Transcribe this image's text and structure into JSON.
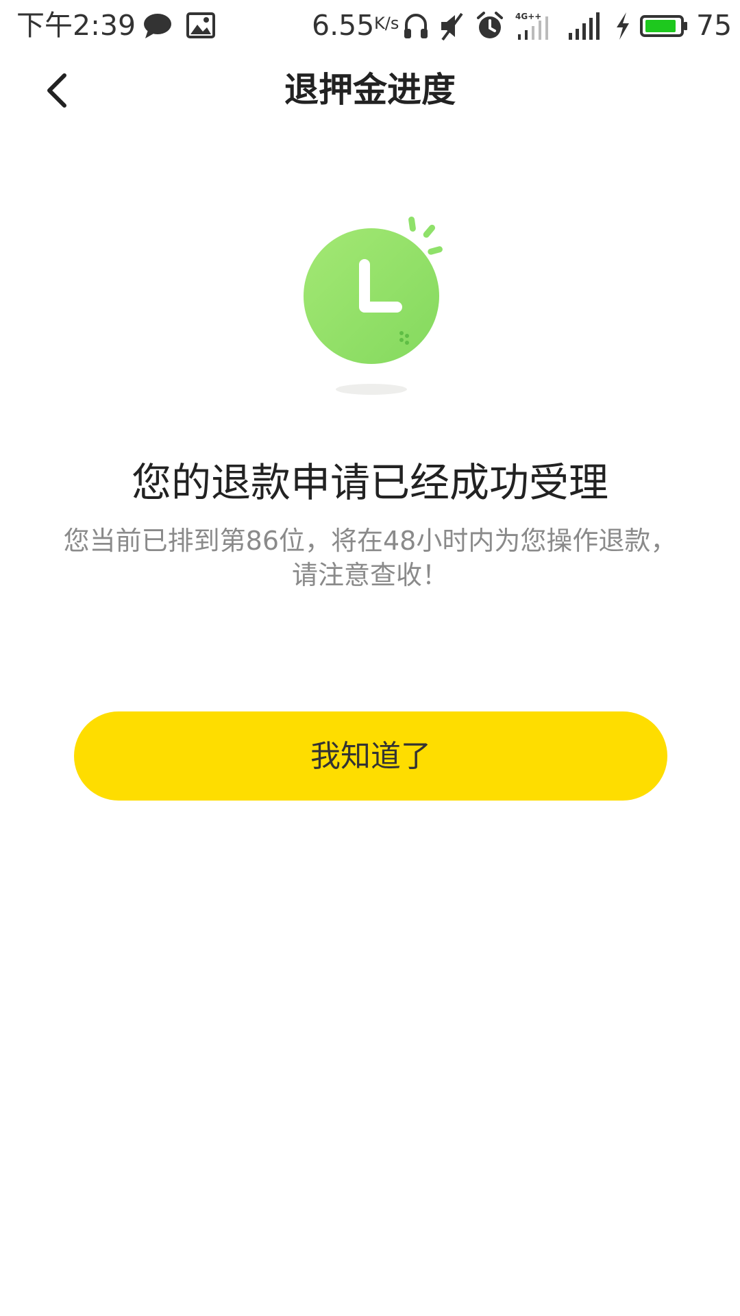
{
  "status_bar": {
    "time": "下午2:39",
    "network_speed": "6.55",
    "network_speed_unit": "K/s",
    "network_type": "4G++",
    "battery_level": "75",
    "icons": [
      "chat-icon",
      "gallery-icon",
      "headphones-icon",
      "mute-icon",
      "alarm-icon",
      "signal-4g-icon",
      "signal-icon",
      "charging-icon",
      "battery-icon"
    ],
    "battery_color": "#1ec81e"
  },
  "nav": {
    "back_icon": "chevron-left-icon",
    "title": "退押金进度"
  },
  "illustration": {
    "icon": "clock-icon",
    "color": "#8fe16a"
  },
  "result": {
    "title": "您的退款申请已经成功受理",
    "description_line1": "您当前已排到第86位，将在48小时内为您操作退款，",
    "description_line2": "请注意查收！"
  },
  "actions": {
    "confirm_label": "我知道了",
    "confirm_color": "#fedd00"
  }
}
